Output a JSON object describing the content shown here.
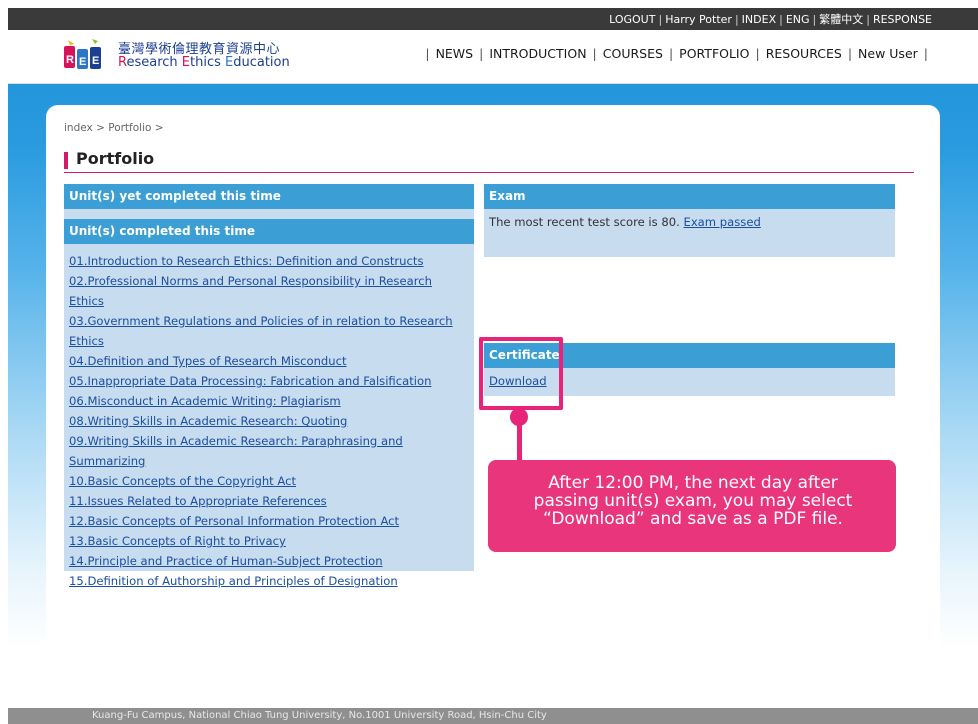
{
  "topbar": {
    "items": [
      "LOGOUT",
      "Harry Potter",
      "INDEX",
      "ENG",
      "繁體中文",
      "RESPONSE"
    ]
  },
  "logo": {
    "zh": "臺灣學術倫理教育資源中心",
    "en_r": "R",
    "en_r_rest": "esearch ",
    "en_e": "E",
    "en_e_rest": "thics ",
    "en_e2": "E",
    "en_e2_rest": "ducation"
  },
  "nav": [
    "NEWS",
    "INTRODUCTION",
    "COURSES",
    "PORTFOLIO",
    "RESOURCES",
    "New User"
  ],
  "breadcrumb": {
    "index": "index",
    "sep": ">",
    "current": "Portfolio",
    "trail_sep": ">"
  },
  "page_title": "Portfolio",
  "left": {
    "yet_completed_header": "Unit(s) yet completed this time",
    "completed_header": "Unit(s) completed this time",
    "units": [
      "01.Introduction to Research Ethics: Definition and Constructs",
      "02.Professional Norms and Personal Responsibility in Research Ethics",
      "03.Government Regulations and Policies of in relation to Research Ethics",
      "04.Definition and Types of Research Misconduct",
      "05.Inappropriate Data Processing: Fabrication and Falsification",
      "06.Misconduct in Academic Writing: Plagiarism",
      "08.Writing Skills in Academic Research: Quoting",
      "09.Writing Skills in Academic Research: Paraphrasing and Summarizing",
      "10.Basic Concepts of the Copyright Act",
      "11.Issues Related to Appropriate References",
      "12.Basic Concepts of Personal Information Protection Act",
      "13.Basic Concepts of Right to Privacy",
      "14.Principle and Practice of Human-Subject Protection",
      "15.Definition of Authorship and Principles of Designation"
    ]
  },
  "exam": {
    "header": "Exam",
    "text": "The most recent test score is 80.",
    "link": "Exam passed"
  },
  "certificate": {
    "header": "Certificate",
    "link": "Download"
  },
  "note": {
    "line1": "After 12:00 PM, the next day after",
    "line2": "passing unit(s) exam, you may select",
    "line3": "“Download”  and save as a PDF file."
  },
  "footer": {
    "text": "Kuang-Fu Campus, National Chiao Tung University, No.1001 University Road, Hsin-Chu City"
  },
  "colors": {
    "accent_pink": "#e8247a",
    "panel_blue": "#3b9fd6",
    "panel_body": "#c8dcf0",
    "brand_blue": "#1c3f91"
  }
}
